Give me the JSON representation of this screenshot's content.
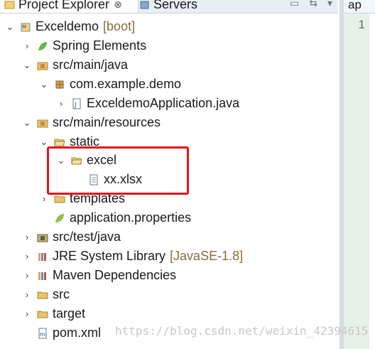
{
  "tabs": {
    "project_explorer": "Project Explorer",
    "close": "⊗",
    "servers": "Servers",
    "editor_tab": "ap"
  },
  "editor": {
    "line_number": "1"
  },
  "tree": {
    "project": "Exceldemo",
    "project_deco": "[boot]",
    "spring_elements": "Spring Elements",
    "src_main_java": "src/main/java",
    "package": "com.example.demo",
    "app_class": "ExceldemoApplication.java",
    "src_main_resources": "src/main/resources",
    "static": "static",
    "excel": "excel",
    "xlsx": "xx.xlsx",
    "templates": "templates",
    "properties": "application.properties",
    "src_test_java": "src/test/java",
    "jre": "JRE System Library",
    "jre_deco": "[JavaSE-1.8]",
    "maven": "Maven Dependencies",
    "src": "src",
    "target": "target",
    "pom": "pom.xml"
  },
  "watermark": "https://blog.csdn.net/weixin_42394615",
  "colors": {
    "highlight": "#e3141b",
    "folder": "#e8c46a",
    "spring": "#6db33f"
  }
}
